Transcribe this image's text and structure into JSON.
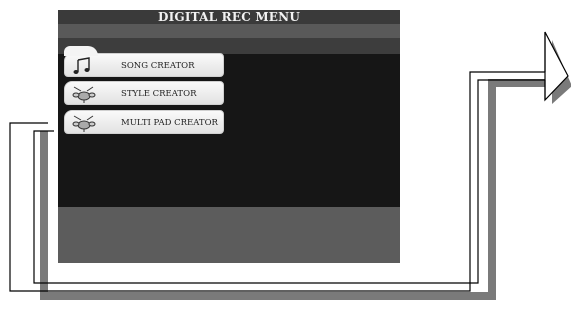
{
  "screen": {
    "title": "DIGITAL REC MENU",
    "menu_items": [
      {
        "label": "SONG CREATOR",
        "icon": "music-note-icon"
      },
      {
        "label": "STYLE CREATOR",
        "icon": "drum-kit-icon"
      },
      {
        "label": "MULTI PAD CREATOR",
        "icon": "drum-kit-icon"
      }
    ]
  }
}
